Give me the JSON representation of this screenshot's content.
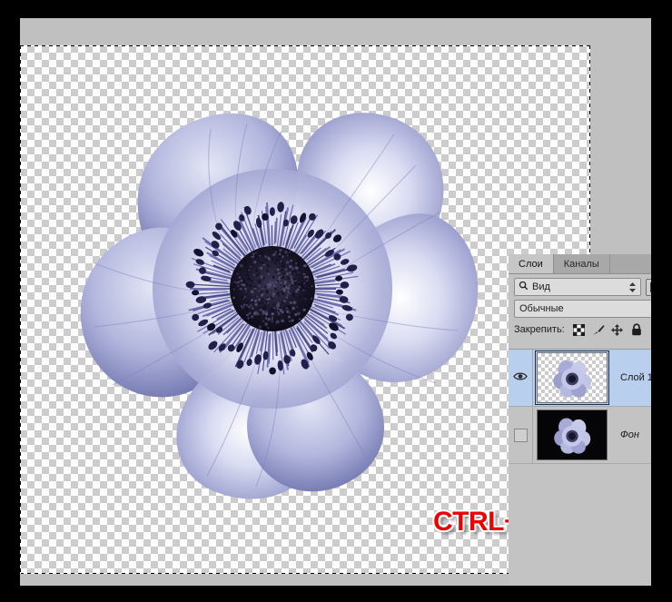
{
  "app": {
    "locale": "ru",
    "document_bg": "#c0c0c0",
    "panel_bg": "#c3c3c3",
    "selection_color": "#b9cfee"
  },
  "canvas": {
    "transparency_checker": true,
    "selection_active": true,
    "selection_label": "marching-ants-selection"
  },
  "hint": {
    "text": "CTRL+SHIFT+I",
    "color": "#ee0000",
    "outline_color": "#ffffff"
  },
  "layers_panel": {
    "tabs": [
      {
        "label": "Слои",
        "active": true
      },
      {
        "label": "Каналы",
        "active": false
      }
    ],
    "filter": {
      "icon": "magnifier-icon",
      "value": "Вид",
      "stepper_icon": "updown-stepper-icon",
      "thumb_toggle_icon": "image-thumbnail-icon"
    },
    "blend_mode": {
      "value": "Обычные"
    },
    "lock": {
      "label": "Закрепить:",
      "items": [
        {
          "name": "lock-transparency-icon",
          "glyph": "checker"
        },
        {
          "name": "lock-image-pixels-icon",
          "glyph": "brush"
        },
        {
          "name": "lock-position-icon",
          "glyph": "move"
        },
        {
          "name": "lock-all-icon",
          "glyph": "padlock"
        }
      ]
    },
    "layers": [
      {
        "name": "Слой 1",
        "visible": true,
        "selected": true,
        "thumb_type": "transparent",
        "italic": false
      },
      {
        "name": "Фон",
        "visible": false,
        "selected": false,
        "thumb_type": "black",
        "italic": true
      }
    ]
  }
}
